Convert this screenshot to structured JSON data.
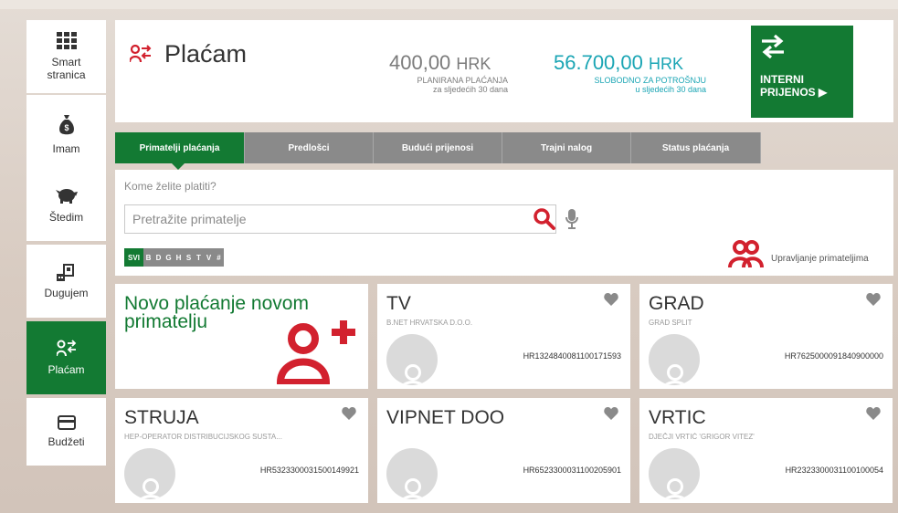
{
  "sidebar": {
    "items": [
      {
        "label": "Smart\nstranica",
        "icon": "grid-icon",
        "glyph": "☷"
      },
      {
        "label": "Imam",
        "icon": "money-bag-icon",
        "glyph": "Š"
      },
      {
        "label": "Štedim",
        "icon": "piggy-bank-icon",
        "glyph": "◘"
      },
      {
        "label": "Dugujem",
        "icon": "house-debt-icon",
        "glyph": "⌂"
      },
      {
        "label": "Plaćam",
        "icon": "person-transfer-icon",
        "glyph": "☺",
        "active": true
      },
      {
        "label": "Budžeti",
        "icon": "card-icon",
        "glyph": "▭"
      }
    ]
  },
  "header": {
    "title": "Plaćam",
    "planned": {
      "amount": "400,00",
      "currency": "HRK",
      "caption1": "PLANIRANA PLAĆANJA",
      "caption2": "za sljedećih 30 dana"
    },
    "free": {
      "amount": "56.700,00",
      "currency": "HRK",
      "caption1": "SLOBODNO ZA POTROŠNJU",
      "caption2": "u sljedećih 30 dana"
    },
    "internal_button": {
      "line1": "INTERNI",
      "line2": "PRIJENOS ▶"
    }
  },
  "tabs": [
    {
      "label": "Primatelji plaćanja",
      "active": true
    },
    {
      "label": "Predlošci"
    },
    {
      "label": "Budući prijenosi"
    },
    {
      "label": "Trajni nalog"
    },
    {
      "label": "Status plaćanja"
    }
  ],
  "search": {
    "prompt": "Kome želite platiti?",
    "placeholder": "Pretražite primatelje",
    "letters": [
      "SVI",
      "B",
      "D",
      "G",
      "H",
      "S",
      "T",
      "V",
      "#"
    ],
    "manage_label": "Upravljanje primateljima"
  },
  "new_payment": {
    "label": "Novo plaćanje novom primatelju"
  },
  "recipients": [
    {
      "name": "TV",
      "subtitle": "B.NET HRVATSKA D.O.O.",
      "iban": "HR1324840081100171593"
    },
    {
      "name": "GRAD",
      "subtitle": "GRAD SPLIT",
      "iban": "HR7625000091840900000"
    },
    {
      "name": "STRUJA",
      "subtitle": "HEP-OPERATOR DISTRIBUCIJSKOG SUSTA...",
      "iban": "HR5323300031500149921"
    },
    {
      "name": "VIPNET DOO",
      "subtitle": "",
      "iban": "HR6523300031100205901"
    },
    {
      "name": "VRTIC",
      "subtitle": "DJEČJI VRTIĆ 'GRIGOR VITEZ'",
      "iban": "HR2323300031100100054"
    }
  ],
  "colors": {
    "brand_green": "#137a33",
    "accent_red": "#d2212e",
    "teal": "#1aa5b4",
    "tab_grey": "#8a8a8a"
  }
}
